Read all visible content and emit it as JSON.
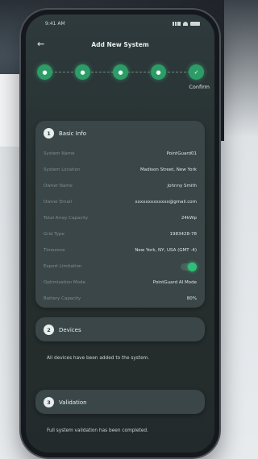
{
  "status_bar": {
    "time": "9:41 AM"
  },
  "header": {
    "title": "Add New System"
  },
  "stepper": {
    "steps": [
      "1",
      "2",
      "3",
      "4",
      "5"
    ],
    "current_label": "Confirm"
  },
  "basic_info": {
    "number": "1",
    "title": "Basic Info",
    "rows": [
      {
        "key": "System Name",
        "value": "PointGuard01"
      },
      {
        "key": "System Location",
        "value": "Madison Street, New York"
      },
      {
        "key": "Owner Name",
        "value": "Johnny Smith"
      },
      {
        "key": "Owner Email",
        "value": "xxxxxxxxxxxxx@gmail.com"
      },
      {
        "key": "Total Array Capacity",
        "value": "24kWp"
      },
      {
        "key": "Grid Type",
        "value": "1983428-78"
      },
      {
        "key": "Timezone",
        "value": "New York, NY, USA (GMT -4)"
      },
      {
        "key": "Export Limitation",
        "value": ""
      },
      {
        "key": "Optimization Mode",
        "value": "PointGuard AI Mode"
      },
      {
        "key": "Battery Capacity",
        "value": "80%"
      }
    ]
  },
  "devices": {
    "number": "2",
    "title": "Devices",
    "note": "All devices have been added to the system."
  },
  "validation": {
    "number": "3",
    "title": "Validation",
    "note": "Full system validation has been completed."
  }
}
